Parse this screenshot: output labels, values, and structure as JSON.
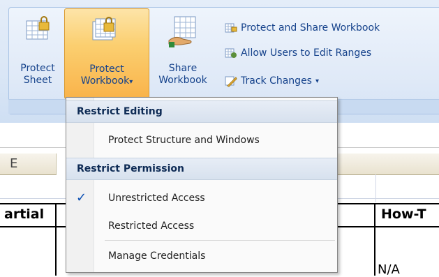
{
  "ribbon": {
    "protect_sheet": {
      "line1": "Protect",
      "line2": "Sheet"
    },
    "protect_workbook": {
      "line1": "Protect",
      "line2": "Workbook",
      "caret": "▾"
    },
    "share_workbook": {
      "line1": "Share",
      "line2": "Workbook"
    },
    "small": {
      "protect_share": "Protect and Share Workbook",
      "allow_users": "Allow Users to Edit Ranges",
      "track_changes": "Track Changes",
      "track_caret": "▾"
    }
  },
  "sheet": {
    "col_e": "E",
    "cell_partial": "artial",
    "cell_howt": "How-T",
    "cell_na": "N/A"
  },
  "menu": {
    "restrict_editing": "Restrict Editing",
    "protect_structure": "Protect Structure and Windows",
    "restrict_permission": "Restrict Permission",
    "unrestricted": "Unrestricted Access",
    "restricted": "Restricted Access",
    "manage_credentials": "Manage Credentials",
    "check": "✓"
  }
}
